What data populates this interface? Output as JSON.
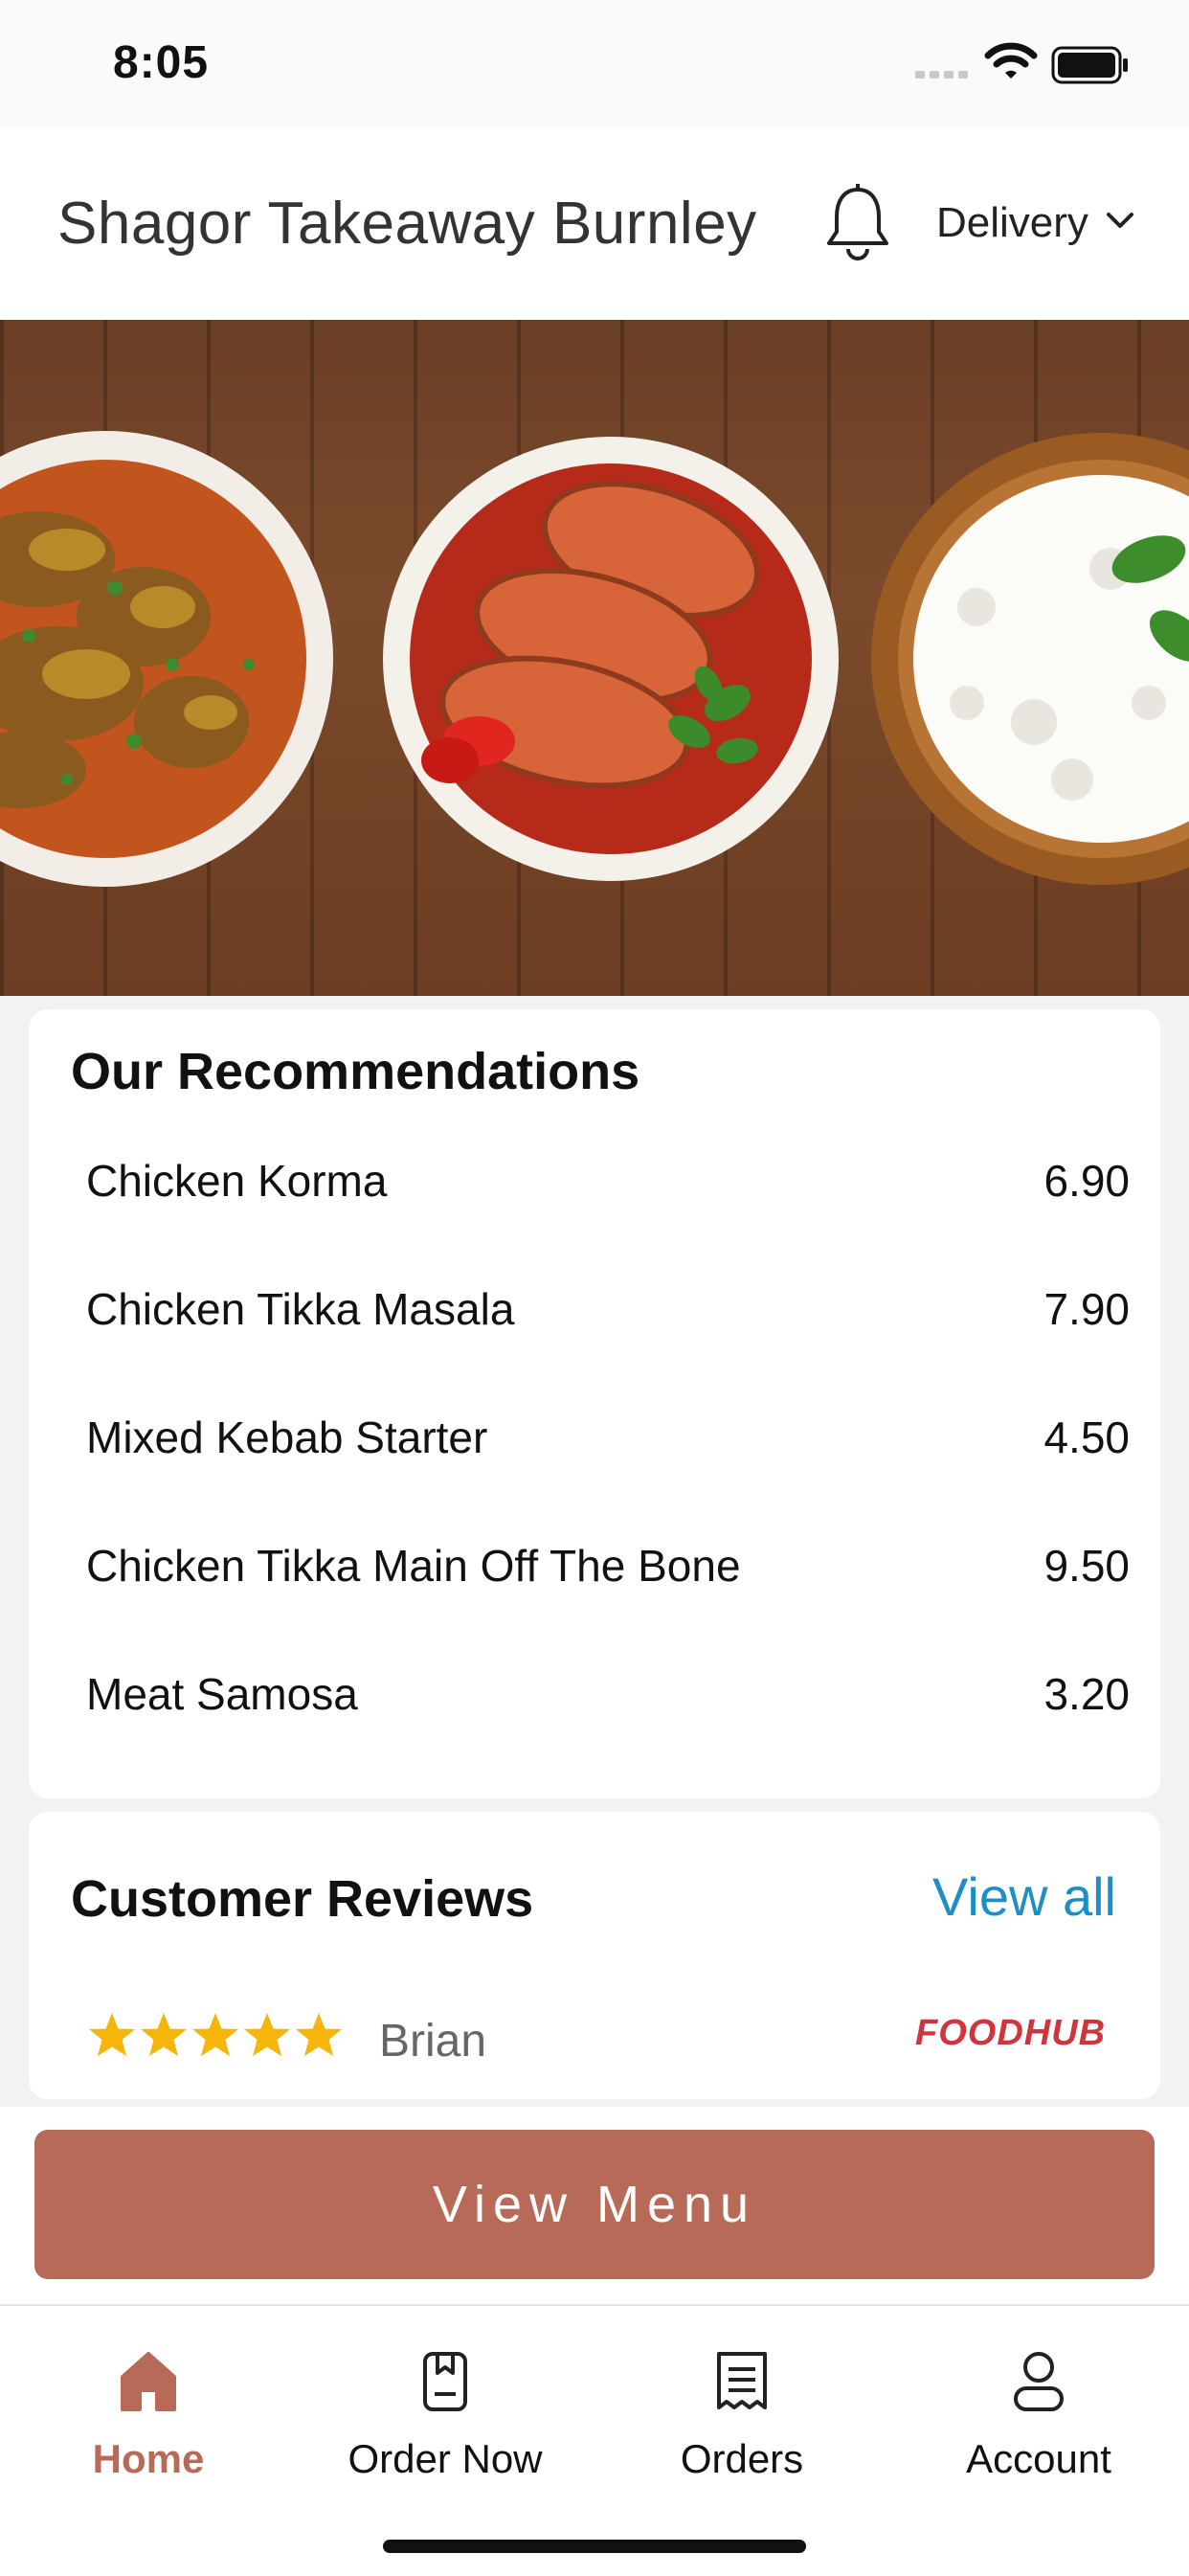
{
  "status_bar": {
    "time": "8:05"
  },
  "header": {
    "title": "Shagor Takeaway Burnley",
    "mode": "Delivery"
  },
  "recommendations": {
    "heading": "Our Recommendations",
    "items": [
      {
        "name": "Chicken Korma",
        "price": "6.90"
      },
      {
        "name": "Chicken Tikka Masala",
        "price": "7.90"
      },
      {
        "name": "Mixed Kebab Starter",
        "price": "4.50"
      },
      {
        "name": "Chicken Tikka Main Off The Bone",
        "price": "9.50"
      },
      {
        "name": "Meat Samosa",
        "price": "3.20"
      }
    ]
  },
  "reviews": {
    "heading": "Customer Reviews",
    "view_all": "View all",
    "items": [
      {
        "rating": 5,
        "reviewer": "Brian",
        "source": "FOODHUB"
      }
    ]
  },
  "view_menu_label": "View Menu",
  "tabs": [
    {
      "label": "Home",
      "icon": "home-icon",
      "active": true
    },
    {
      "label": "Order Now",
      "icon": "order-now-icon",
      "active": false
    },
    {
      "label": "Orders",
      "icon": "orders-icon",
      "active": false
    },
    {
      "label": "Account",
      "icon": "account-icon",
      "active": false
    }
  ],
  "colors": {
    "accent": "#b86a58",
    "link": "#1e8fc6",
    "star": "#f5b50a",
    "brand_red": "#d0343c"
  }
}
